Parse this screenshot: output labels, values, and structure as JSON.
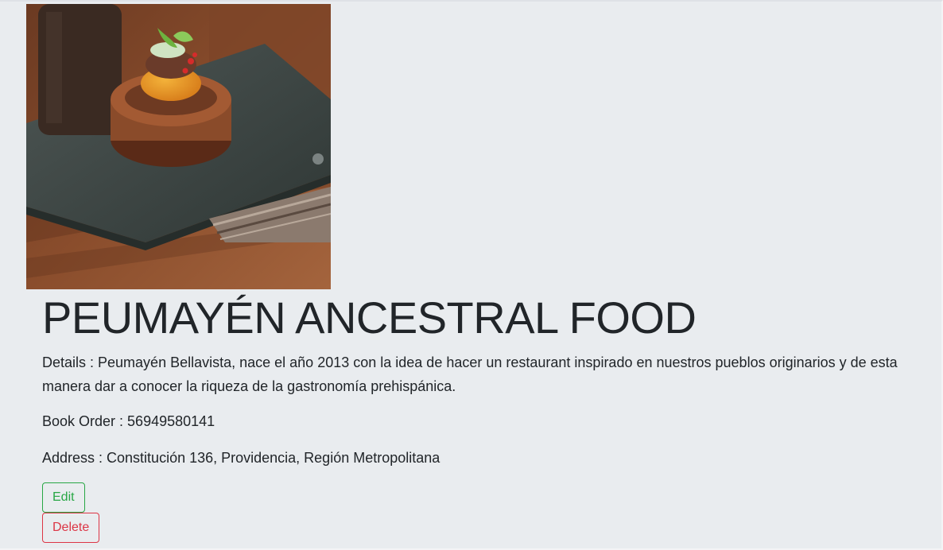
{
  "restaurant": {
    "image_alt": "restaurant dish photo",
    "title": "PEUMAYÉN ANCESTRAL FOOD",
    "details": "Details : Peumayén Bellavista, nace el año 2013 con la idea de hacer un restaurant inspirado en nuestros pueblos originarios y de esta manera dar a conocer la riqueza de la gastronomía prehispánica.",
    "book_order": "Book Order : 56949580141",
    "address": "Address : Constitución 136, Providencia, Región Metropolitana"
  },
  "actions": {
    "edit_label": "Edit",
    "delete_label": "Delete"
  },
  "colors": {
    "background": "#e9ecef",
    "edit": "#28a745",
    "delete": "#dc3545",
    "text": "#212529"
  }
}
